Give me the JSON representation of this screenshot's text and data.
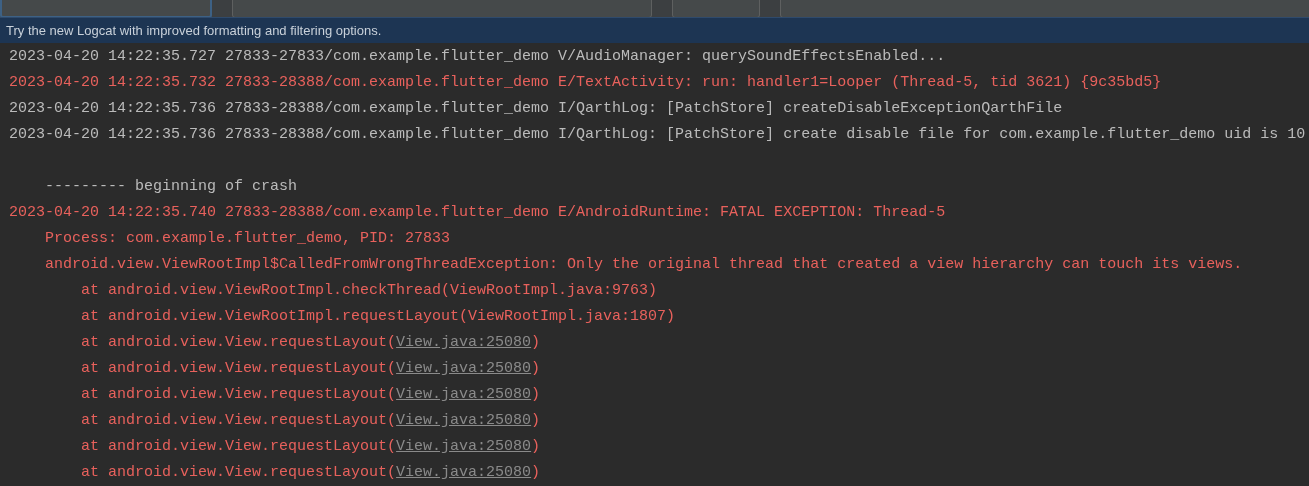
{
  "toolbar": {
    "fields": [
      {
        "focused": true
      },
      {
        "focused": false
      },
      {
        "focused": false
      },
      {
        "focused": false
      }
    ]
  },
  "banner": {
    "text": "Try the new Logcat with improved formatting and filtering options."
  },
  "log_lines": [
    {
      "kind": "plain",
      "text": "2023-04-20 14:22:35.727 27833-27833/com.example.flutter_demo V/AudioManager: querySoundEffectsEnabled..."
    },
    {
      "kind": "error",
      "text": "2023-04-20 14:22:35.732 27833-28388/com.example.flutter_demo E/TextActivity: run: handler1=Looper (Thread-5, tid 3621) {9c35bd5}"
    },
    {
      "kind": "plain",
      "text": "2023-04-20 14:22:35.736 27833-28388/com.example.flutter_demo I/QarthLog: [PatchStore] createDisableExceptionQarthFile"
    },
    {
      "kind": "plain",
      "text": "2023-04-20 14:22:35.736 27833-28388/com.example.flutter_demo I/QarthLog: [PatchStore] create disable file for com.example.flutter_demo uid is 10"
    },
    {
      "kind": "blank"
    },
    {
      "kind": "plain",
      "text": "    --------- beginning of crash"
    },
    {
      "kind": "error",
      "text": "2023-04-20 14:22:35.740 27833-28388/com.example.flutter_demo E/AndroidRuntime: FATAL EXCEPTION: Thread-5"
    },
    {
      "kind": "error",
      "text": "    Process: com.example.flutter_demo, PID: 27833"
    },
    {
      "kind": "error",
      "text": "    android.view.ViewRootImpl$CalledFromWrongThreadException: Only the original thread that created a view hierarchy can touch its views."
    },
    {
      "kind": "error",
      "text": "        at android.view.ViewRootImpl.checkThread(ViewRootImpl.java:9763)"
    },
    {
      "kind": "error",
      "text": "        at android.view.ViewRootImpl.requestLayout(ViewRootImpl.java:1807)"
    },
    {
      "kind": "error",
      "text": "        at android.view.View.requestLayout(",
      "link": "View.java:25080",
      "suffix": ")"
    },
    {
      "kind": "error",
      "text": "        at android.view.View.requestLayout(",
      "link": "View.java:25080",
      "suffix": ")"
    },
    {
      "kind": "error",
      "text": "        at android.view.View.requestLayout(",
      "link": "View.java:25080",
      "suffix": ")"
    },
    {
      "kind": "error",
      "text": "        at android.view.View.requestLayout(",
      "link": "View.java:25080",
      "suffix": ")"
    },
    {
      "kind": "error",
      "text": "        at android.view.View.requestLayout(",
      "link": "View.java:25080",
      "suffix": ")"
    },
    {
      "kind": "error",
      "text": "        at android.view.View.requestLayout(",
      "link": "View.java:25080",
      "suffix": ")"
    }
  ]
}
